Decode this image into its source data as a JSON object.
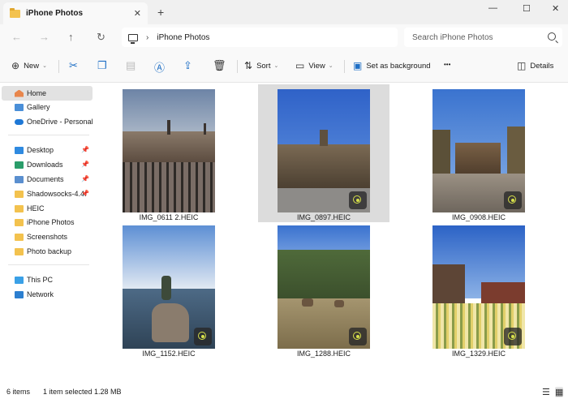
{
  "window": {
    "tab_title": "iPhone Photos",
    "new_tab": "+",
    "close_tab": "✕",
    "minimize": "—",
    "maximize": "☐",
    "close": "✕"
  },
  "nav": {
    "back": "←",
    "forward": "→",
    "up": "↑",
    "refresh": "↻",
    "breadcrumb_sep": "›",
    "location": "iPhone Photos",
    "search_placeholder": "Search iPhone Photos"
  },
  "toolbar": {
    "new_label": "New",
    "sort_label": "Sort",
    "view_label": "View",
    "set_background_label": "Set as background",
    "more": "•••",
    "details_label": "Details",
    "caret": "⌄"
  },
  "sidebar": {
    "items": [
      {
        "label": "Home",
        "icon": "home-icon",
        "selected": true
      },
      {
        "label": "Gallery",
        "icon": "gallery-icon"
      },
      {
        "label": "OneDrive - Personal",
        "icon": "cloud-icon"
      },
      {
        "label": "Desktop",
        "icon": "desktop-folder-icon",
        "pinned": true
      },
      {
        "label": "Downloads",
        "icon": "download-icon",
        "pinned": true
      },
      {
        "label": "Documents",
        "icon": "documents-icon",
        "pinned": true
      },
      {
        "label": "Shadowsocks-4.4.",
        "icon": "folder-icon",
        "pinned": true
      },
      {
        "label": "HEIC",
        "icon": "folder-icon"
      },
      {
        "label": "iPhone Photos",
        "icon": "folder-icon"
      },
      {
        "label": "Screenshots",
        "icon": "folder-icon"
      },
      {
        "label": "Photo backup",
        "icon": "folder-icon"
      },
      {
        "label": "This PC",
        "icon": "computer-icon"
      },
      {
        "label": "Network",
        "icon": "network-icon"
      }
    ],
    "pin_glyph": "📌"
  },
  "files": [
    {
      "name": "IMG_0611 2.HEIC",
      "selected": false,
      "live": false
    },
    {
      "name": "IMG_0897.HEIC",
      "selected": true,
      "live": true
    },
    {
      "name": "IMG_0908.HEIC",
      "selected": false,
      "live": true
    },
    {
      "name": "IMG_1152.HEIC",
      "selected": false,
      "live": true
    },
    {
      "name": "IMG_1288.HEIC",
      "selected": false,
      "live": true
    },
    {
      "name": "IMG_1329.HEIC",
      "selected": false,
      "live": true
    }
  ],
  "status": {
    "item_count": "6 items",
    "selection": "1 item selected",
    "size": "1.28 MB"
  },
  "colors": {
    "accent": "#1f6fc5",
    "folder": "#f3c24e",
    "selected_bg": "#dcdcdc"
  }
}
